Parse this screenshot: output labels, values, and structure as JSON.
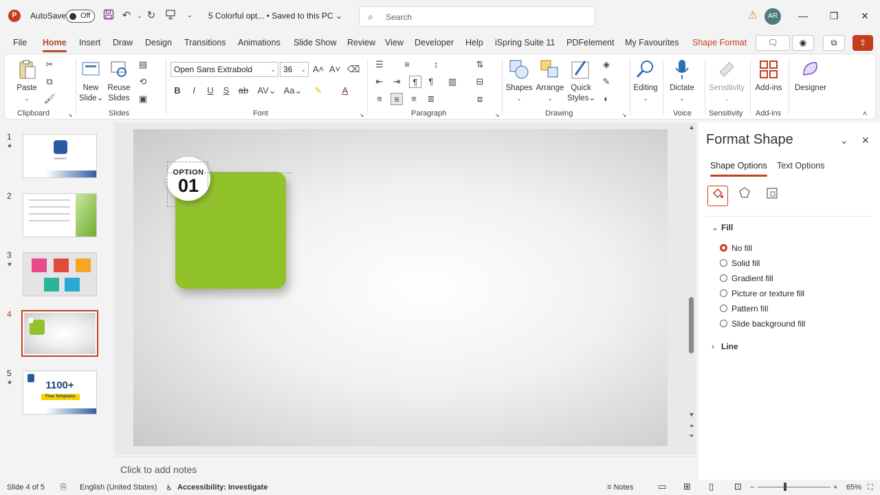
{
  "titlebar": {
    "app_logo": "P",
    "autosave_label": "AutoSave",
    "autosave_state": "Off",
    "doc_title": "5 Colorful opt... • Saved to this PC",
    "search_placeholder": "Search",
    "user_initials": "AR"
  },
  "tabs": [
    "File",
    "Home",
    "Insert",
    "Draw",
    "Design",
    "Transitions",
    "Animations",
    "Slide Show",
    "Review",
    "View",
    "Developer",
    "Help",
    "iSpring Suite 11",
    "PDFelement",
    "My Favourites",
    "Shape Format"
  ],
  "active_tab": "Home",
  "ribbon": {
    "groups": {
      "clipboard": "Clipboard",
      "slides": "Slides",
      "font": "Font",
      "paragraph": "Paragraph",
      "drawing": "Drawing",
      "voice": "Voice",
      "sensitivity": "Sensitivity",
      "addins": "Add-ins"
    },
    "paste": "Paste",
    "new_slide_1": "New",
    "new_slide_2": "Slide",
    "reuse_1": "Reuse",
    "reuse_2": "Slides",
    "font_name": "Open Sans Extrabold",
    "font_size": "36",
    "shapes": "Shapes",
    "arrange": "Arrange",
    "quick_styles_1": "Quick",
    "quick_styles_2": "Styles",
    "editing": "Editing",
    "dictate": "Dictate",
    "sensitivity": "Sensitivity",
    "addins": "Add-ins",
    "designer": "Designer"
  },
  "slides": [
    {
      "num": "1",
      "label": "FREEPPT"
    },
    {
      "num": "2",
      "label": ""
    },
    {
      "num": "3",
      "label": ""
    },
    {
      "num": "4",
      "label": ""
    },
    {
      "num": "5",
      "big": "1100+",
      "sub": "Free Templates"
    }
  ],
  "selected_slide": 4,
  "canvas": {
    "option_label": "OPTION",
    "option_number": "01"
  },
  "notes_placeholder": "Click to add notes",
  "format_pane": {
    "title": "Format Shape",
    "tab_shape": "Shape Options",
    "tab_text": "Text Options",
    "fill_section": "Fill",
    "fill_options": [
      "No fill",
      "Solid fill",
      "Gradient fill",
      "Picture or texture fill",
      "Pattern fill",
      "Slide background fill"
    ],
    "selected_fill": "No fill",
    "line_section": "Line"
  },
  "status": {
    "slide_info": "Slide 4 of 5",
    "language": "English (United States)",
    "accessibility": "Accessibility: Investigate",
    "notes": "Notes",
    "zoom": "65%"
  },
  "colors": {
    "accent": "#c43e1c",
    "shape_green": "#92c22a"
  }
}
